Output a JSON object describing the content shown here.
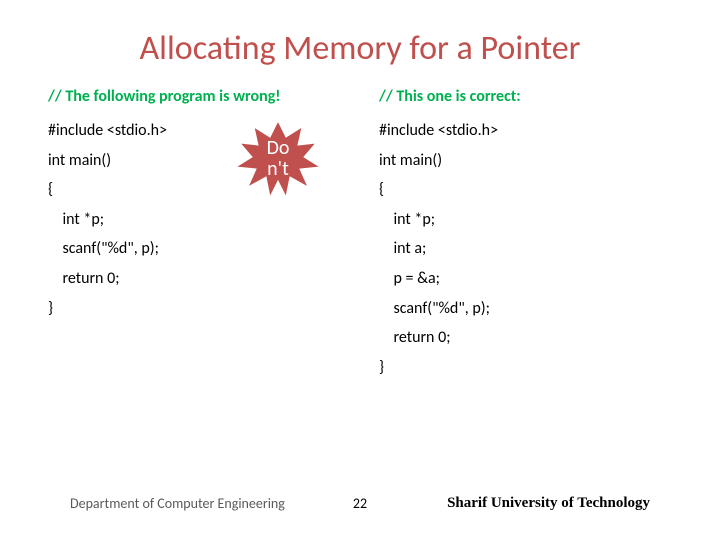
{
  "title": "Allocating Memory for a Pointer",
  "left": {
    "comment": "// The following program is wrong!",
    "lines": [
      "#include <stdio.h>",
      "int main()",
      "{",
      "    int *p;",
      "    scanf(\"%d\", p);",
      "    return 0;",
      "}"
    ]
  },
  "right": {
    "comment": "// This one is correct:",
    "lines": [
      "#include <stdio.h>",
      "int main()",
      "{",
      "    int *p;",
      "    int a;",
      "    p = &a;",
      "    scanf(\"%d\", p);",
      "    return 0;",
      "}"
    ]
  },
  "badge": {
    "line1": "Do",
    "line2": "n't"
  },
  "footer": {
    "left": "Department of Computer Engineering",
    "center": "22",
    "right": "Sharif University of Technology"
  },
  "colors": {
    "title": "#c0504d",
    "comment": "#00b050",
    "badge": "#c0504d"
  }
}
